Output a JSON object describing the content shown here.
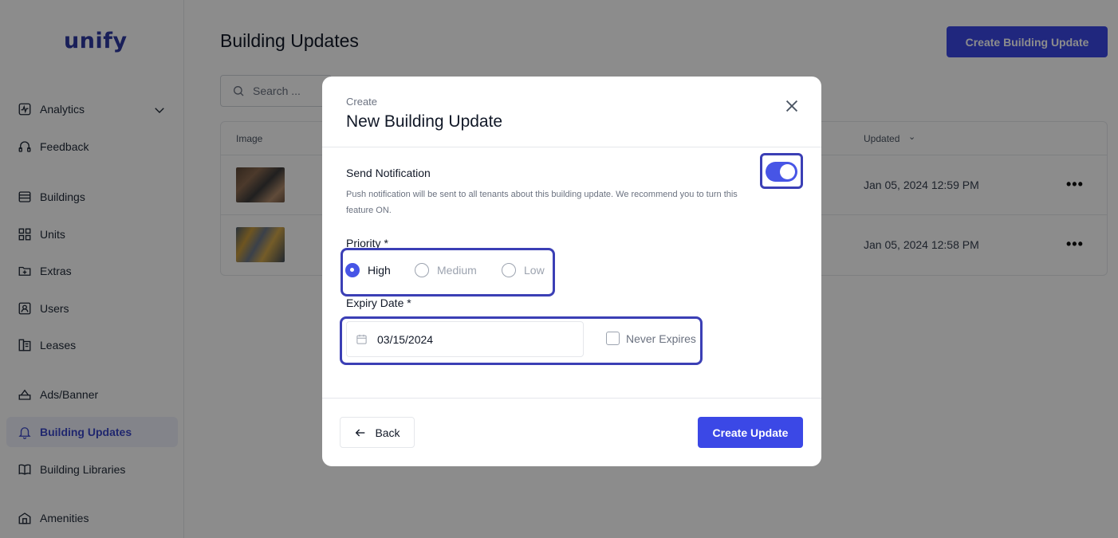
{
  "app": {
    "logo": "unify"
  },
  "sidebar": {
    "items": [
      {
        "label": "Analytics",
        "icon": "analytics-icon",
        "active": false
      },
      {
        "label": "Feedback",
        "icon": "feedback-icon",
        "active": false
      },
      {
        "label": "Buildings",
        "icon": "buildings-icon",
        "active": false
      },
      {
        "label": "Units",
        "icon": "units-icon",
        "active": false
      },
      {
        "label": "Extras",
        "icon": "extras-icon",
        "active": false
      },
      {
        "label": "Users",
        "icon": "users-icon",
        "active": false
      },
      {
        "label": "Leases",
        "icon": "leases-icon",
        "active": false
      },
      {
        "label": "Ads/Banner",
        "icon": "ads-banner-icon",
        "active": false
      },
      {
        "label": "Building Updates",
        "icon": "bell-icon",
        "active": true
      },
      {
        "label": "Building Libraries",
        "icon": "book-icon",
        "active": false
      },
      {
        "label": "Amenities",
        "icon": "amenities-icon",
        "active": false
      }
    ]
  },
  "main": {
    "title": "Building Updates",
    "create_button": "Create Building Update",
    "search_placeholder": "Search ...",
    "table": {
      "columns": {
        "image": "Image",
        "updated": "Updated"
      },
      "rows": [
        {
          "updated": "Jan 05, 2024 12:59 PM"
        },
        {
          "updated": "Jan 05, 2024 12:58 PM"
        }
      ],
      "actions_label": "•••"
    }
  },
  "modal": {
    "subtitle": "Create",
    "title": "New Building Update",
    "notification": {
      "title": "Send Notification",
      "description": "Push notification will be sent to all tenants about this building update. We recommend you to turn this feature ON.",
      "enabled": true
    },
    "priority": {
      "label": "Priority *",
      "options": [
        "High",
        "Medium",
        "Low"
      ],
      "selected": "High"
    },
    "expiry": {
      "label": "Expiry Date *",
      "value": "03/15/2024",
      "never_expires_label": "Never Expires",
      "never_expires_checked": false
    },
    "back_label": "Back",
    "submit_label": "Create Update"
  },
  "colors": {
    "primary": "#3b48e6",
    "highlight": "#3b3fb5",
    "active_nav_bg": "#eef0fb"
  }
}
